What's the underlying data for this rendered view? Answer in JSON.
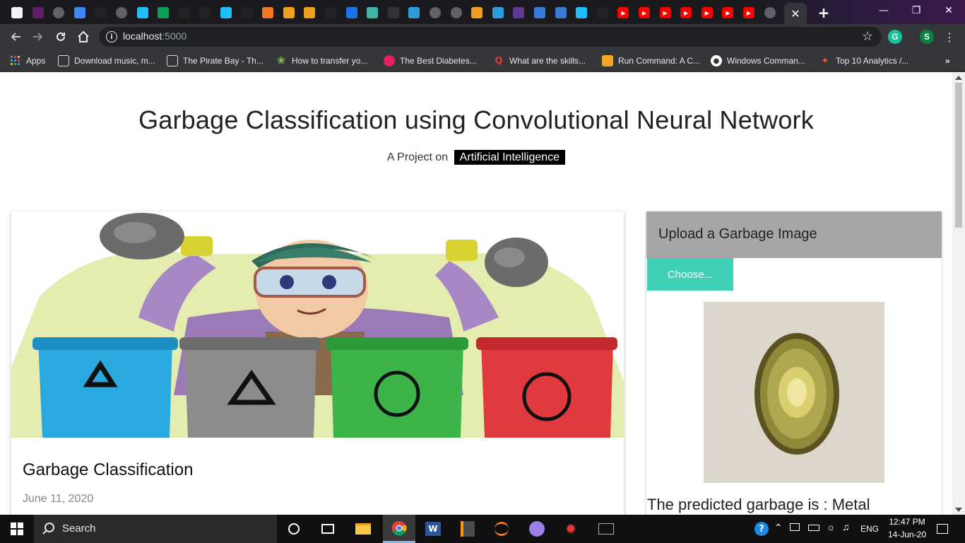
{
  "browser": {
    "tabs_favicons": [
      "sketch-app",
      "slack",
      "generic",
      "google-forms",
      "github",
      "generic",
      "kaggle",
      "sheets",
      "github",
      "github",
      "kaggle",
      "github",
      "jupyter",
      "notebook",
      "notebook",
      "github",
      "is",
      "tumblr",
      "dots",
      "cloud",
      "generic",
      "generic",
      "notebook",
      "cloud",
      "edx",
      "infinity",
      "infinity",
      "kaggle",
      "github",
      "youtube",
      "youtube",
      "youtube",
      "youtube",
      "youtube",
      "youtube",
      "youtube",
      "generic",
      "active"
    ],
    "url_host": "localhost",
    "url_port": ":5000",
    "profile_initial": "S",
    "grammarly_initial": "G",
    "bookmarks": [
      {
        "label": "Apps",
        "icon": "apps-grid-icon"
      },
      {
        "label": "Download music, m...",
        "icon": "monitor-icon"
      },
      {
        "label": "The Pirate Bay - Th...",
        "icon": "monitor-icon"
      },
      {
        "label": "How to transfer yo...",
        "icon": "leaf-icon"
      },
      {
        "label": "The Best Diabetes...",
        "icon": "pin-icon"
      },
      {
        "label": "What are the skills...",
        "icon": "quora-icon"
      },
      {
        "label": "Run Command: A C...",
        "icon": "stack-icon"
      },
      {
        "label": "Windows Comman...",
        "icon": "globe-icon"
      },
      {
        "label": "Top 10 Analytics /...",
        "icon": "flame-icon"
      }
    ]
  },
  "page": {
    "title": "Garbage Classification using Convolutional Neural Network",
    "subtitle_prefix": "A Project on",
    "subtitle_tag": "Artificial Intelligence",
    "card": {
      "title": "Garbage Classification",
      "date": "June 11, 2020"
    },
    "upload": {
      "heading": "Upload a Garbage Image",
      "button": "Choose...",
      "prediction": "The predicted garbage is : Metal"
    }
  },
  "taskbar": {
    "search_label": "Search",
    "language": "ENG",
    "time": "12:47 PM",
    "date": "14-Jun-20"
  },
  "colors": {
    "accent": "#3fd0b6",
    "upload_header": "#a6a6a6",
    "bin_blue": "#29a9de",
    "bin_gray": "#8c8c8c",
    "bin_green": "#3cb44a",
    "bin_red": "#e03a3e"
  }
}
